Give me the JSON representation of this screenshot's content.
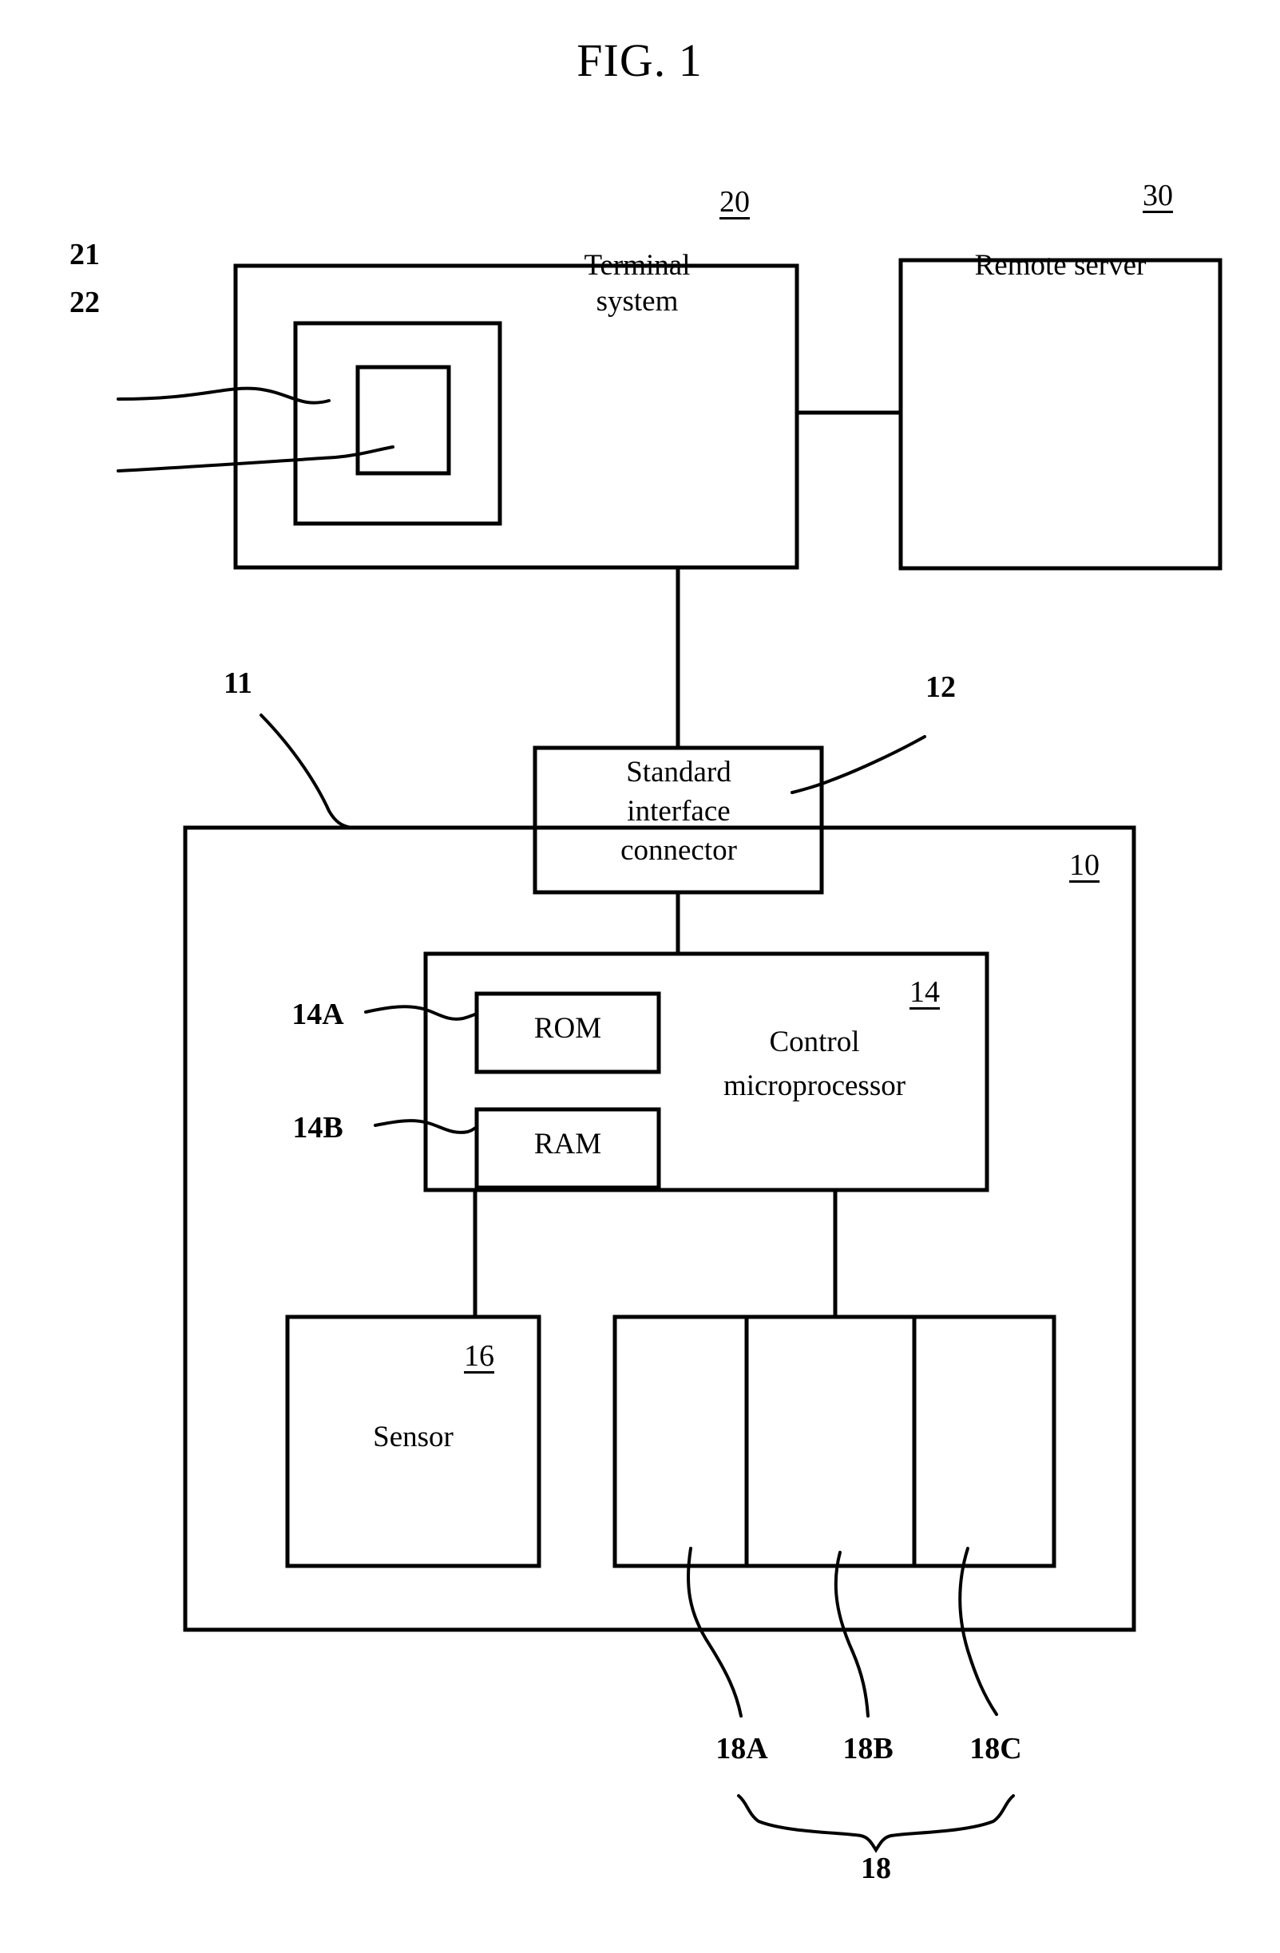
{
  "figure": {
    "title": "FIG. 1"
  },
  "boxes": {
    "terminal_system": {
      "label": "Terminal system",
      "label_line1": "Terminal",
      "label_line2": "system",
      "ref": "20"
    },
    "remote_server": {
      "label": "Remote server",
      "ref": "30"
    },
    "standard_interface_connector": {
      "label": "Standard interface connector",
      "label_line1": "Standard",
      "label_line2": "interface",
      "label_line3": "connector",
      "ref": "12"
    },
    "control_microprocessor": {
      "label": "Control microprocessor",
      "label_line1": "Control",
      "label_line2": "microprocessor",
      "ref": "14"
    },
    "rom": {
      "label": "ROM",
      "ref": "14A"
    },
    "ram": {
      "label": "RAM",
      "ref": "14B"
    },
    "sensor": {
      "label": "Sensor",
      "ref": "16"
    },
    "device_outer": {
      "ref": "10"
    },
    "inner_module_21": {
      "ref": "21"
    },
    "inner_module_22": {
      "ref": "22"
    },
    "device_boundary_11": {
      "ref": "11"
    },
    "slot_a": {
      "ref": "18A"
    },
    "slot_b": {
      "ref": "18B"
    },
    "slot_c": {
      "ref": "18C"
    },
    "slot_group": {
      "ref": "18"
    }
  },
  "colors": {
    "ink": "#000000",
    "paper": "#ffffff"
  }
}
